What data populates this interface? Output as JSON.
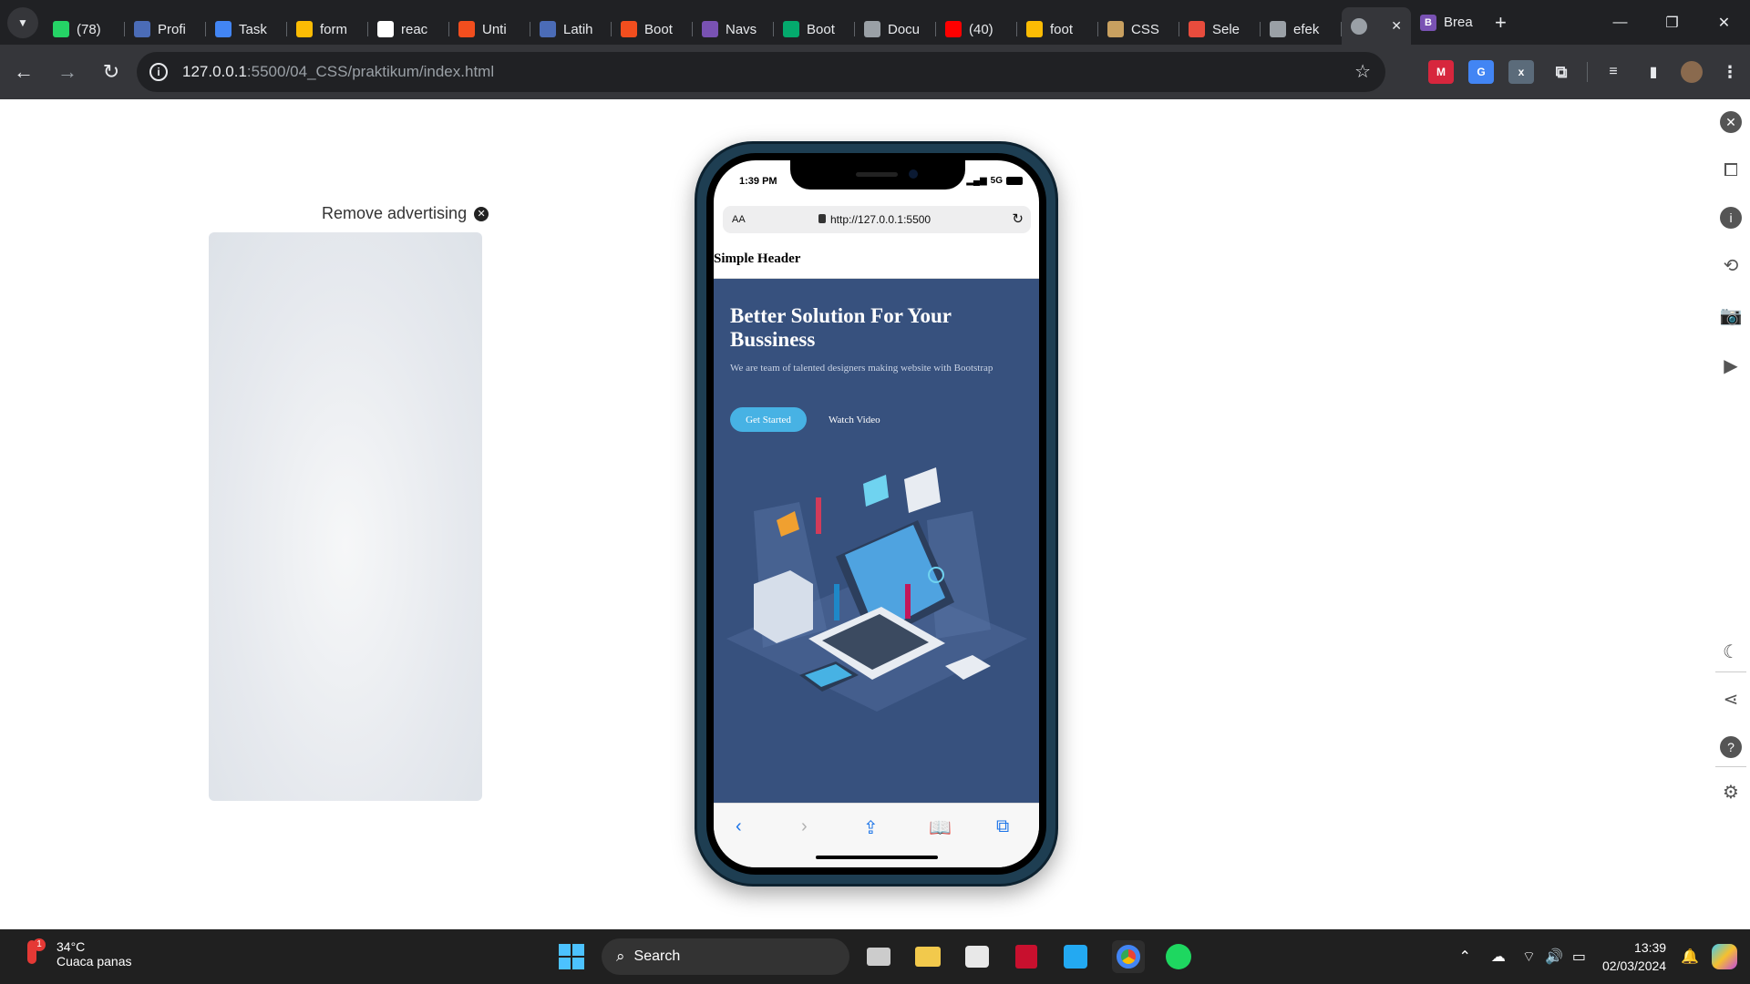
{
  "browser": {
    "tabs": [
      {
        "label": "(78)",
        "icon": "whatsapp-icon",
        "color": "#25d366"
      },
      {
        "label": "Profi",
        "icon": "site-icon",
        "color": "#4b6cb7"
      },
      {
        "label": "Task",
        "icon": "docs-icon",
        "color": "#4285f4"
      },
      {
        "label": "form",
        "icon": "drive-icon",
        "color": "#fbbc04"
      },
      {
        "label": "reac",
        "icon": "github-icon",
        "color": "#ffffff"
      },
      {
        "label": "Unti",
        "icon": "figma-icon",
        "color": "#f24e1e"
      },
      {
        "label": "Latih",
        "icon": "site-icon",
        "color": "#4b6cb7"
      },
      {
        "label": "Boot",
        "icon": "figma-icon",
        "color": "#f24e1e"
      },
      {
        "label": "Navs",
        "icon": "bootstrap-icon",
        "color": "#7952b3"
      },
      {
        "label": "Boot",
        "icon": "w3schools-icon",
        "color": "#04aa6d"
      },
      {
        "label": "Docu",
        "icon": "globe-icon",
        "color": "#9aa0a6"
      },
      {
        "label": "(40)",
        "icon": "youtube-icon",
        "color": "#ff0000"
      },
      {
        "label": "foot",
        "icon": "drive-icon",
        "color": "#fbbc04"
      },
      {
        "label": "CSS",
        "icon": "css-icon",
        "color": "#c8a060"
      },
      {
        "label": "Sele",
        "icon": "site-icon",
        "color": "#e84c3d"
      },
      {
        "label": "efek",
        "icon": "site-icon",
        "color": "#9aa0a6"
      }
    ],
    "active_tab": {
      "icon": "globe-icon"
    },
    "last_tab": {
      "label": "Brea",
      "icon": "bootstrap-icon",
      "color": "#7952b3"
    },
    "url_host": "127.0.0.1",
    "url_path": ":5500/04_CSS/praktikum/index.html"
  },
  "page": {
    "remove_ad": "Remove advertising"
  },
  "phone": {
    "time": "1:39 PM",
    "network": "5G",
    "text_size": "AA",
    "address": "http://127.0.0.1:5500",
    "header_title": "Simple Header",
    "hero_title": "Better Solution For Your Bussiness",
    "hero_subtitle": "We are team of talented designers making website with Bootstrap",
    "btn_get_started": "Get Started",
    "btn_watch_video": "Watch Video",
    "colors": {
      "hero_bg": "#37517e",
      "accent": "#47b2e4"
    }
  },
  "taskbar": {
    "temp": "34°C",
    "weather": "Cuaca panas",
    "weather_badge": "1",
    "search": "Search",
    "time": "13:39",
    "date": "02/03/2024"
  }
}
